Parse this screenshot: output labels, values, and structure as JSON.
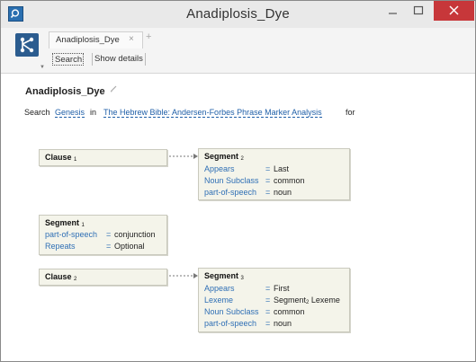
{
  "window": {
    "title": "Anadiplosis_Dye"
  },
  "tabs": [
    {
      "label": "Anadiplosis_Dye",
      "close_glyph": "×"
    }
  ],
  "new_tab_glyph": "+",
  "toolbar": {
    "search_label": "Search",
    "details_label": "Show details"
  },
  "query": {
    "title": "Anadiplosis_Dye",
    "search_prefix": "Search",
    "book": "Genesis",
    "in_word": "in",
    "resource": "The Hebrew Bible: Andersen-Forbes Phrase Marker Analysis",
    "for_word": "for"
  },
  "nodes": {
    "clause1": {
      "label": "Clause",
      "index": "1"
    },
    "segment2": {
      "label": "Segment",
      "index": "2",
      "features": [
        {
          "key": "Appears",
          "value": "Last"
        },
        {
          "key": "Noun Subclass",
          "value": "common"
        },
        {
          "key": "part-of-speech",
          "value": "noun"
        }
      ]
    },
    "segment1": {
      "label": "Segment",
      "index": "1",
      "features": [
        {
          "key": "part-of-speech",
          "value": "conjunction"
        },
        {
          "key": "Repeats",
          "value": "Optional"
        }
      ]
    },
    "clause2": {
      "label": "Clause",
      "index": "2"
    },
    "segment3": {
      "label": "Segment",
      "index": "3",
      "features": [
        {
          "key": "Appears",
          "value": "First"
        },
        {
          "key": "Lexeme",
          "value": "Segment",
          "value_sub": "2",
          "value_tail": " Lexeme"
        },
        {
          "key": "Noun Subclass",
          "value": "common"
        },
        {
          "key": "part-of-speech",
          "value": "noun"
        }
      ]
    }
  },
  "equals_glyph": "=",
  "icons": [
    "app-search-icon",
    "minimize-icon",
    "maximize-icon",
    "close-icon",
    "graph-query-icon",
    "edit-pencil-icon"
  ],
  "colors": {
    "close_button": "#c7373a",
    "link": "#1f5fa8",
    "feature_key": "#2f6fb5",
    "node_bg": "#f4f4ea",
    "tool_icon_bg": "#2b5c8f"
  }
}
